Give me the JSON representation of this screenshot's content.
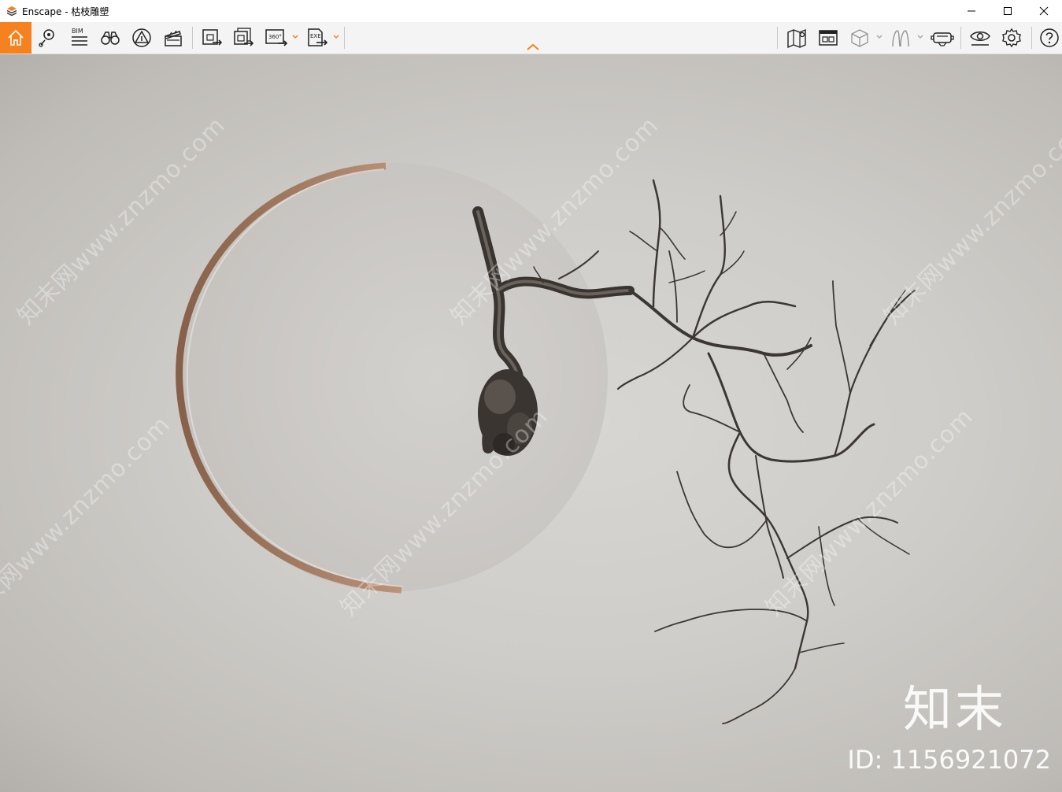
{
  "window": {
    "app_name": "Enscape",
    "separator": " - ",
    "document_title": "枯枝雕塑"
  },
  "toolbar": {
    "bim_label": "BIM",
    "pano_label": "360°",
    "exe_label": "EXE",
    "accent_color": "#f5821f",
    "icons_left": [
      "home-icon",
      "location-pin-icon",
      "bim-info-icon",
      "binoculars-icon",
      "atmosphere-icon",
      "clapperboard-icon",
      "screenshot-export-icon",
      "batch-export-icon",
      "panorama-360-icon",
      "exe-export-icon"
    ],
    "icons_right": [
      "map-icon",
      "view-management-icon",
      "cube-icon",
      "asset-library-icon",
      "vr-headset-icon",
      "visibility-icon",
      "settings-icon",
      "help-icon"
    ]
  },
  "viewport": {
    "watermark_text": "知末网www.znzmo.com",
    "brand_mark": "知末",
    "brand_id": "ID: 1156921072"
  }
}
